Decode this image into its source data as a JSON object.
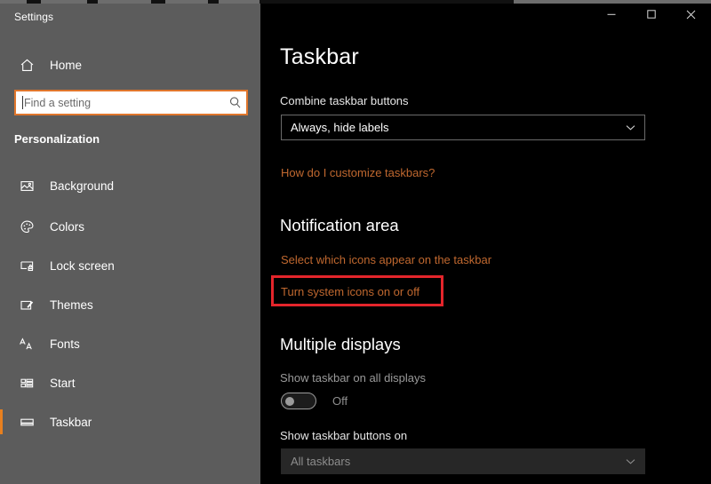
{
  "window": {
    "app_title": "Settings",
    "caption_buttons": [
      {
        "name": "minimize",
        "glyph": "─"
      },
      {
        "name": "maximize",
        "glyph": "□"
      },
      {
        "name": "close",
        "glyph": "✕"
      }
    ]
  },
  "sidebar": {
    "home_label": "Home",
    "search": {
      "placeholder": "Find a setting",
      "value": "",
      "icon": "search-icon"
    },
    "section_header": "Personalization",
    "items": [
      {
        "label": "Background",
        "icon": "image-icon",
        "selected": false
      },
      {
        "label": "Colors",
        "icon": "palette-icon",
        "selected": false
      },
      {
        "label": "Lock screen",
        "icon": "lock-screen-icon",
        "selected": false
      },
      {
        "label": "Themes",
        "icon": "brush-icon",
        "selected": false
      },
      {
        "label": "Fonts",
        "icon": "fonts-icon",
        "selected": false
      },
      {
        "label": "Start",
        "icon": "start-tiles-icon",
        "selected": false
      },
      {
        "label": "Taskbar",
        "icon": "taskbar-icon",
        "selected": true
      }
    ],
    "accent_color": "#e8801f",
    "background_color": "#5c5c5c"
  },
  "main": {
    "page_title": "Taskbar",
    "combine_label": "Combine taskbar buttons",
    "combine_value": "Always, hide labels",
    "customize_link": "How do I customize taskbars?",
    "notification_area": {
      "heading": "Notification area",
      "link_select_icons": "Select which icons appear on the taskbar",
      "link_system_icons": "Turn system icons on or off"
    },
    "multiple_displays": {
      "heading": "Multiple displays",
      "show_all_label": "Show taskbar on all displays",
      "show_all_state": "Off",
      "buttons_on_label": "Show taskbar buttons on",
      "buttons_on_value": "All taskbars"
    },
    "link_color": "#c0682f",
    "highlight_color": "#e4252b"
  }
}
